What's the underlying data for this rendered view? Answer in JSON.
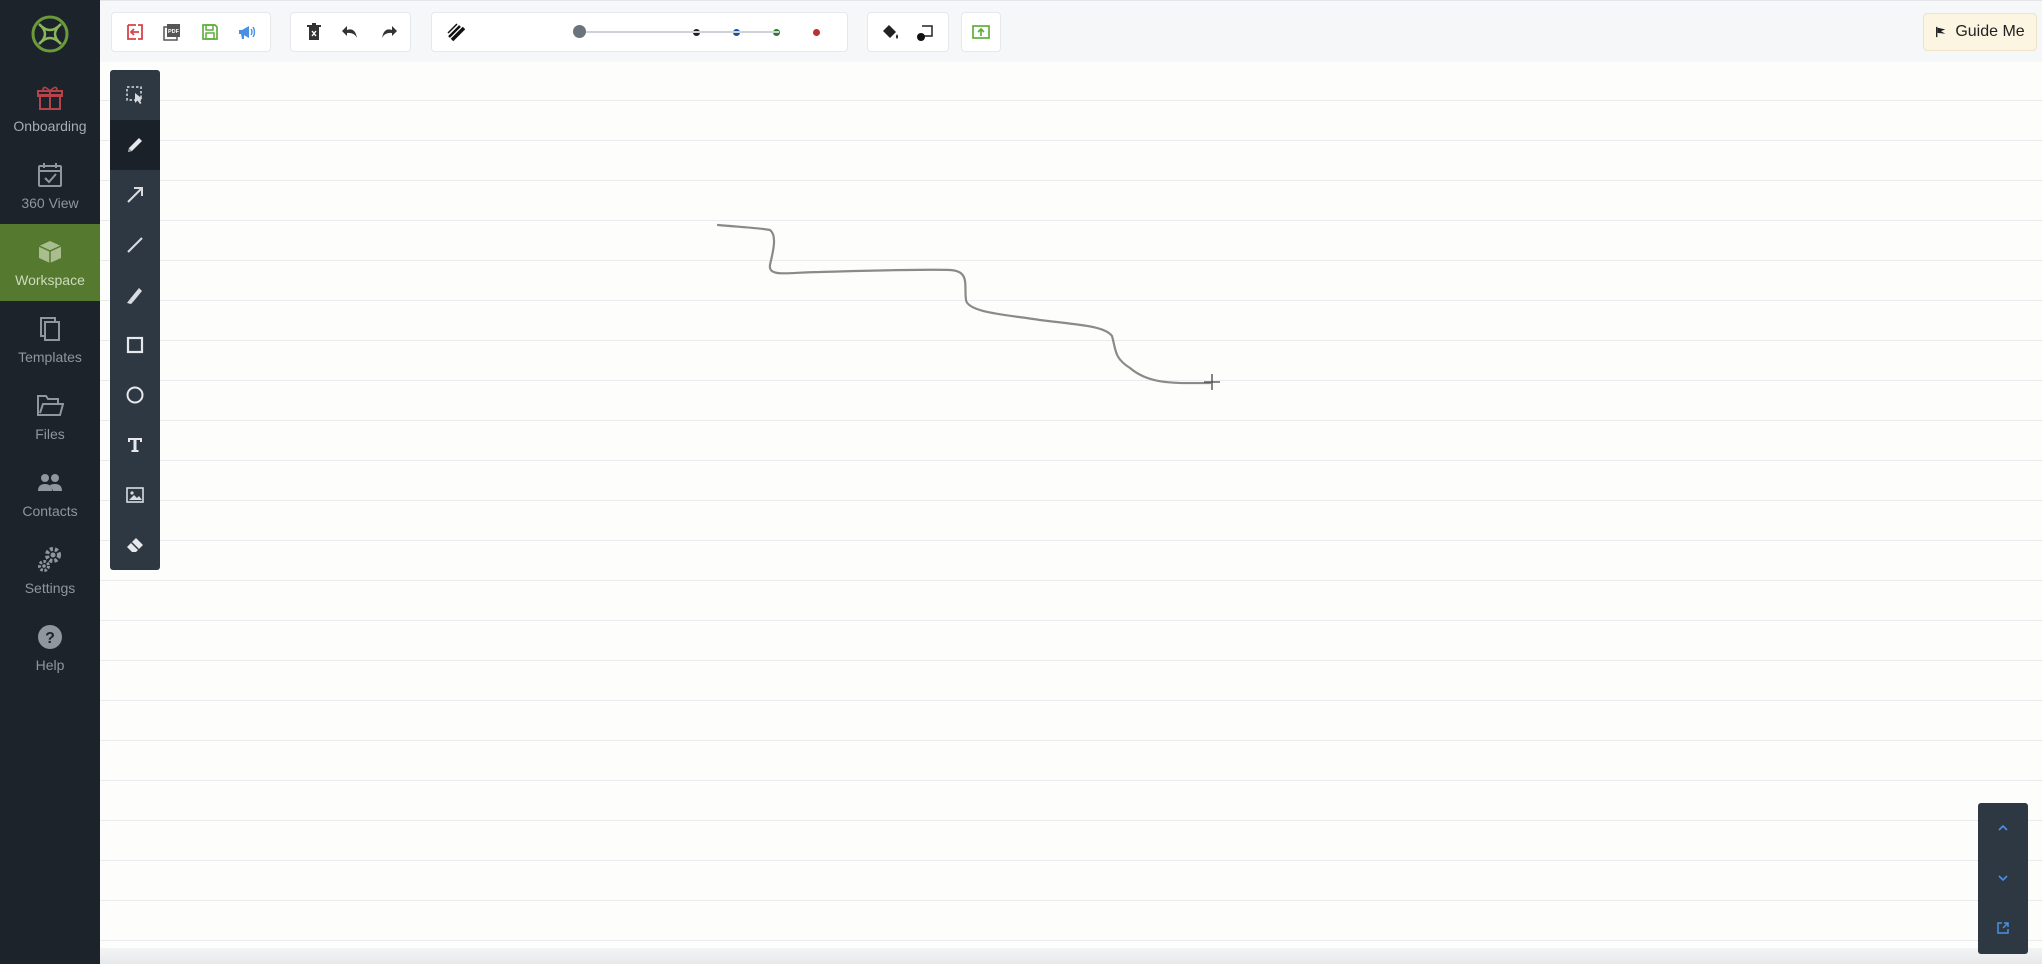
{
  "sidebar": {
    "items": [
      {
        "label": "Onboarding",
        "icon": "gift-icon"
      },
      {
        "label": "360 View",
        "icon": "calendar-check-icon"
      },
      {
        "label": "Workspace",
        "icon": "cube-icon",
        "active": true
      },
      {
        "label": "Templates",
        "icon": "copy-icon"
      },
      {
        "label": "Files",
        "icon": "folder-icon"
      },
      {
        "label": "Contacts",
        "icon": "users-icon"
      },
      {
        "label": "Settings",
        "icon": "gears-icon"
      },
      {
        "label": "Help",
        "icon": "question-circle-icon"
      }
    ]
  },
  "toolbar": {
    "file_actions": [
      "exit-icon",
      "pdf-icon",
      "save-icon",
      "megaphone-icon"
    ],
    "edit_actions": [
      "delete-icon",
      "undo-icon",
      "redo-icon"
    ],
    "stroke_width_icon": "line-weight-icon",
    "stroke_width": 0.0,
    "colors": [
      "#222222",
      "#1f4e9c",
      "#2f7a2f",
      "#b83232"
    ],
    "fill_icon": "fill-bucket-icon",
    "stroke_color_icon": "stroke-color-icon",
    "present_icon": "present-icon"
  },
  "guide_me": {
    "label": "Guide Me",
    "icon": "flag-icon"
  },
  "tools": [
    {
      "name": "select",
      "icon": "select-icon"
    },
    {
      "name": "pen",
      "icon": "pen-icon",
      "active": true
    },
    {
      "name": "arrow",
      "icon": "arrow-icon"
    },
    {
      "name": "line",
      "icon": "line-icon"
    },
    {
      "name": "highlighter",
      "icon": "highlighter-icon"
    },
    {
      "name": "rectangle",
      "icon": "rectangle-icon"
    },
    {
      "name": "circle",
      "icon": "circle-icon"
    },
    {
      "name": "text",
      "icon": "text-icon"
    },
    {
      "name": "image",
      "icon": "image-icon"
    },
    {
      "name": "eraser",
      "icon": "eraser-icon"
    }
  ],
  "scroll_controls": [
    "chevron-up-icon",
    "chevron-down-icon",
    "export-icon"
  ],
  "colors": {
    "sidebar_bg": "#1c232b",
    "active_nav": "#55792f",
    "palette_bg": "#2e3843",
    "accent_blue": "#4a90e2",
    "stroke": "#8a8a8a"
  }
}
